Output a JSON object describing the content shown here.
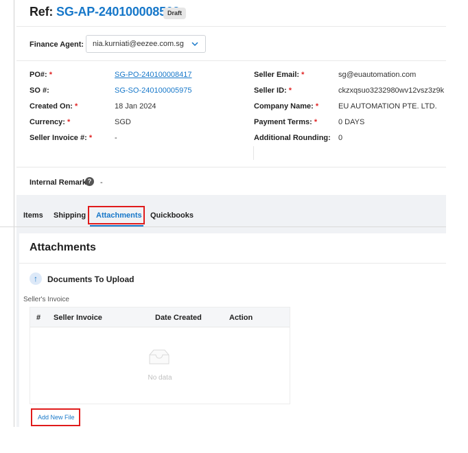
{
  "header": {
    "ref_prefix": "Ref:",
    "ref_number": "SG-AP-240100008563",
    "status_badge": "Draft"
  },
  "finance_agent": {
    "label": "Finance Agent:",
    "value": "nia.kurniati@eezee.com.sg"
  },
  "details_left": [
    {
      "label": "PO#:",
      "required": "*",
      "value": "SG-PO-240100008417"
    },
    {
      "label": "SO #:",
      "required": "",
      "value": "SG-SO-240100005975"
    },
    {
      "label": "Created On:",
      "required": "*",
      "value": "18 Jan 2024"
    },
    {
      "label": "Currency:",
      "required": "*",
      "value": "SGD"
    },
    {
      "label": "Seller Invoice #:",
      "required": "*",
      "value": "-"
    }
  ],
  "details_right": [
    {
      "label": "Seller Email:",
      "required": "*",
      "value": "sg@euautomation.com"
    },
    {
      "label": "Seller ID:",
      "required": "*",
      "value": "ckzxqsuo3232980wv12vsz3z9k"
    },
    {
      "label": "Company Name:",
      "required": "*",
      "value": "EU AUTOMATION PTE. LTD."
    },
    {
      "label": "Payment Terms:",
      "required": "*",
      "value": "0 DAYS"
    },
    {
      "label": "Additional Rounding:",
      "required": "",
      "value": "0"
    }
  ],
  "internal_remark": {
    "label": "Internal Remark:",
    "help_glyph": "?",
    "value": "-"
  },
  "tabs": [
    {
      "label": "Items"
    },
    {
      "label": "Shipping"
    },
    {
      "label": "Attachments"
    },
    {
      "label": "Quickbooks"
    }
  ],
  "attachments": {
    "title": "Attachments",
    "upload_icon_glyph": "↑",
    "section_title": "Documents To Upload",
    "subsection": "Seller's Invoice",
    "columns": [
      "#",
      "Seller Invoice",
      "Date Created",
      "Action"
    ],
    "rows": [],
    "empty_text": "No data",
    "add_button": "Add New File"
  },
  "colors": {
    "accent": "#1677c9",
    "required": "#e02424",
    "highlight_box": "#e01a1a",
    "band_bg": "#f0f2f5"
  }
}
